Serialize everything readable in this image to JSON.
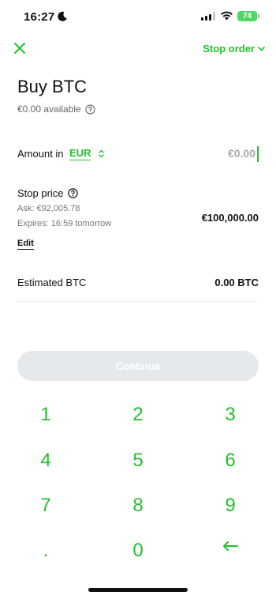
{
  "status_bar": {
    "time": "16:27",
    "battery": "74"
  },
  "header": {
    "close_icon": "close-icon",
    "order_type": "Stop order",
    "accent_color": "#21c12c"
  },
  "title": "Buy BTC",
  "available": "€0.00 available",
  "amount": {
    "label": "Amount in",
    "currency": "EUR",
    "value": "€0.00"
  },
  "stop_price": {
    "label": "Stop price",
    "ask": "Ask: €92,005.78",
    "expires": "Expires: 16:59 tomorrow",
    "value": "€100,000.00",
    "edit_label": "Edit"
  },
  "estimated": {
    "label": "Estimated BTC",
    "value": "0.00 BTC"
  },
  "continue_label": "Continue",
  "keypad": {
    "keys": [
      "1",
      "2",
      "3",
      "4",
      "5",
      "6",
      "7",
      "8",
      "9",
      ".",
      "0"
    ],
    "backspace_icon": "backspace-arrow-icon"
  }
}
